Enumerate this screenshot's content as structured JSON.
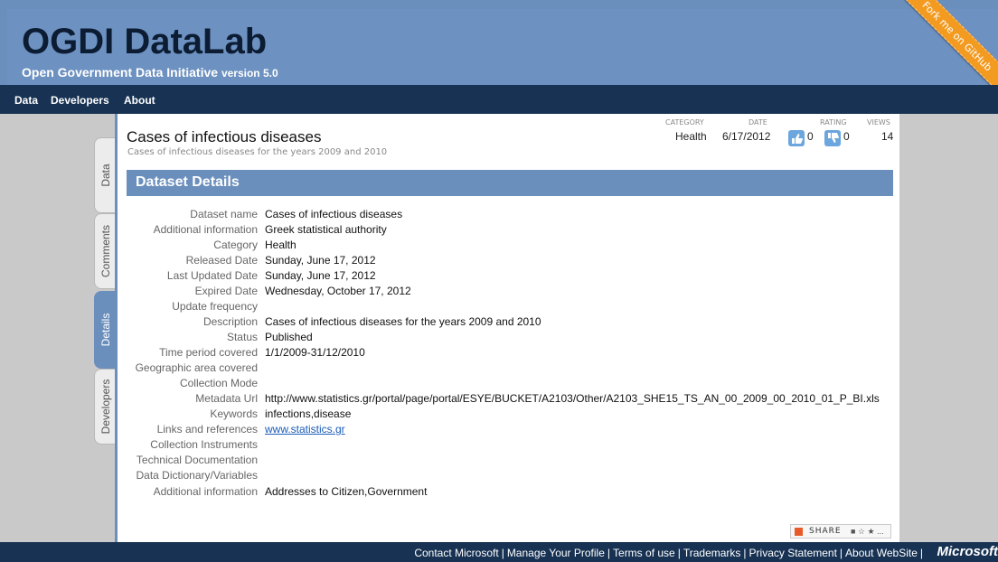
{
  "header": {
    "title": "OGDI DataLab",
    "subtitle": "Open Government Data Initiative",
    "version": "version 5.0",
    "ribbon": "Fork me on GitHub"
  },
  "nav": {
    "items": [
      "Data",
      "Developers",
      "About"
    ]
  },
  "side_tabs": [
    {
      "label": "Data",
      "active": false
    },
    {
      "label": "Comments",
      "active": false
    },
    {
      "label": "Details",
      "active": true
    },
    {
      "label": "Developers",
      "active": false
    }
  ],
  "dataset": {
    "title": "Cases of infectious diseases",
    "subtitle": "Cases of infectious diseases for the years 2009 and 2010",
    "meta": {
      "category_label": "CATEGORY",
      "category": "Health",
      "date_label": "DATE",
      "date": "6/17/2012",
      "rating_label": "RATING",
      "rating_up": "0",
      "rating_down": "0",
      "views_label": "VIEWS",
      "views": "14"
    }
  },
  "details": {
    "heading": "Dataset Details",
    "rows": [
      {
        "label": "Dataset name",
        "value": "Cases of infectious diseases"
      },
      {
        "label": "Additional information",
        "value": "Greek statistical authority"
      },
      {
        "label": "Category",
        "value": "Health"
      },
      {
        "label": "Released Date",
        "value": "Sunday, June 17, 2012"
      },
      {
        "label": "Last Updated Date",
        "value": "Sunday, June 17, 2012"
      },
      {
        "label": "Expired Date",
        "value": "Wednesday, October 17, 2012"
      },
      {
        "label": "Update frequency",
        "value": ""
      },
      {
        "label": "Description",
        "value": "Cases of infectious diseases for the years 2009 and 2010"
      },
      {
        "label": "Status",
        "value": "Published"
      },
      {
        "label": "Time period covered",
        "value": "1/1/2009-31/12/2010"
      },
      {
        "label": "Geographic area covered",
        "value": ""
      },
      {
        "label": "Collection Mode",
        "value": ""
      },
      {
        "label": "Metadata Url",
        "value": "http://www.statistics.gr/portal/page/portal/ESYE/BUCKET/A2103/Other/A2103_SHE15_TS_AN_00_2009_00_2010_01_P_BI.xls"
      },
      {
        "label": "Keywords",
        "value": "infections,disease"
      },
      {
        "label": "Links and references",
        "value": "www.statistics.gr"
      },
      {
        "label": "Collection Instruments",
        "value": ""
      },
      {
        "label": "Technical Documentation",
        "value": ""
      },
      {
        "label": "Data Dictionary/Variables",
        "value": ""
      },
      {
        "label": "Additional information",
        "value": "Addresses to Citizen,Government"
      }
    ]
  },
  "share": {
    "label": "SHARE",
    "services": "■ ☆ ★ ..."
  },
  "footer": {
    "links": [
      "Contact Microsoft",
      "Manage Your Profile",
      "Terms of use",
      "Trademarks",
      "Privacy Statement",
      "About WebSite"
    ],
    "logo": "Microsoft"
  }
}
